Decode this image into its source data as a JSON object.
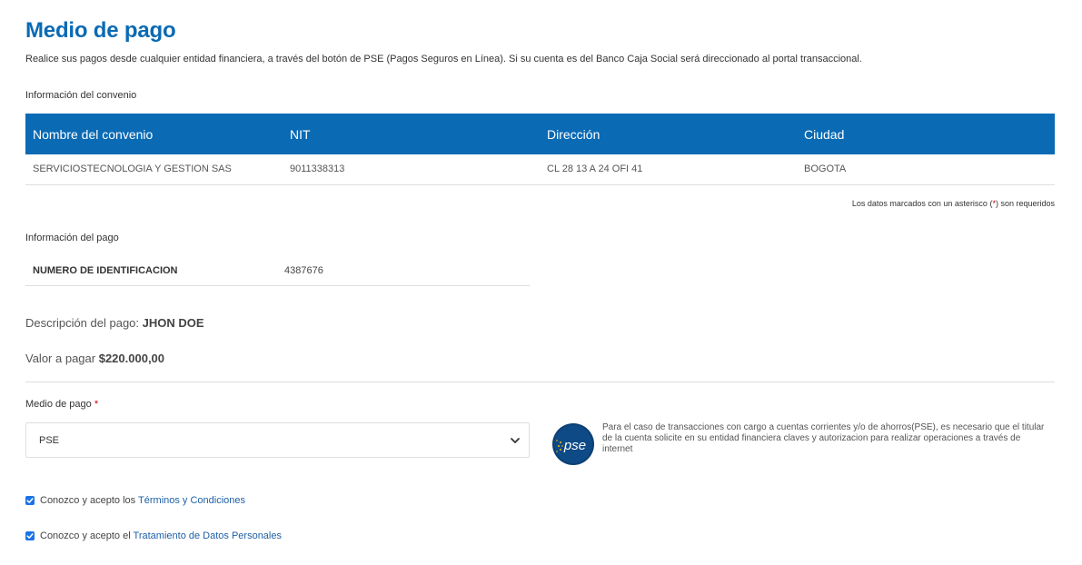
{
  "header": {
    "title": "Medio de pago",
    "subtitle": "Realice sus pagos desde cualquier entidad financiera, a través del botón de PSE (Pagos Seguros en Línea). Si su cuenta es del Banco Caja Social será direccionado al portal transaccional."
  },
  "convenio": {
    "section_label": "Información del convenio",
    "headers": [
      "Nombre del convenio",
      "NIT",
      "Dirección",
      "Ciudad"
    ],
    "row": [
      "SERVICIOSTECNOLOGIA Y GESTION SAS",
      "9011338313",
      "CL 28 13 A 24 OFI 41",
      "BOGOTA"
    ]
  },
  "required_note": {
    "before": "Los datos marcados con un asterisco (",
    "asterisk": "*",
    "after": ") son requeridos"
  },
  "pago": {
    "section_label": "Información del pago",
    "id_label": "NUMERO DE IDENTIFICACION",
    "id_value": "4387676",
    "descripcion_label": "Descripción del pago:",
    "descripcion_value": "JHON DOE",
    "valor_label": "Valor a pagar",
    "valor_value": "$220.000,00"
  },
  "medio_pago": {
    "label": "Medio de pago",
    "asterisk": "*",
    "selected": "PSE",
    "pse_logo_text": "pse",
    "pse_info": "Para el caso de transacciones con cargo a cuentas corrientes y/o de ahorros(PSE), es necesario que el titular de la cuenta solicite en su entidad financiera claves y autorizacion para realizar operaciones a través de internet"
  },
  "checks": {
    "terms_prefix": "Conozco y acepto los",
    "terms_link": "Términos y Condiciones",
    "data_prefix": "Conozco y acepto el",
    "data_link": "Tratamiento de Datos Personales"
  },
  "colors": {
    "brand": "#0a6ab4",
    "checkbox": "#1a73e8",
    "link": "#1f5fa6",
    "required": "#cc0000"
  }
}
